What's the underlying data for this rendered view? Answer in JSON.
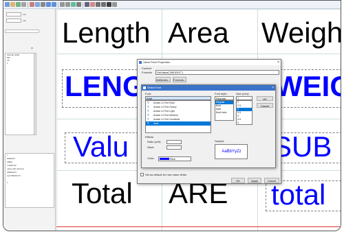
{
  "toolbar_icons": [
    "new-icon",
    "open-icon",
    "save-icon",
    "print-icon",
    "cut-icon",
    "copy-icon",
    "paste-icon",
    "undo-icon",
    "redo-icon",
    "zoom-in-icon",
    "zoom-out-icon",
    "grid-icon",
    "align-icon",
    "text-icon",
    "image-icon",
    "line-icon",
    "rect-icon",
    "barcode-icon",
    "settings-icon"
  ],
  "left_panel": {
    "field1_unit": "mm",
    "field2_unit": "mm",
    "tree_items": [
      "VALUE_SIZE",
      "MG",
      "T5",
      "1"
    ],
    "lower_items": [
      "t",
      "WEIGHT",
      "AREA",
      "\"LENGTH\"",
      "value with decimal",
      "(WEIGHT)",
      "rce(\"WEIGHT\")",
      "",
      "1"
    ]
  },
  "canvas": {
    "headers": [
      "Length",
      "Area",
      "Weigh"
    ],
    "row2": [
      "LENG",
      "WEIG"
    ],
    "row3": [
      "Valu",
      "SUB"
    ],
    "row4": [
      "Total",
      "ARE",
      "total"
    ]
  },
  "value_dialog": {
    "title": "Value Field Properties",
    "content_label": "Content",
    "formula_label": "Formula",
    "formula_value": "GetValue(\"WEIGHT\")",
    "attributes_button": "Attributes...",
    "formula_button": "Formula...",
    "checkbox_label": "Set as default for new value fields",
    "ok_button": "OK",
    "apply_button": "Apply",
    "cancel_button": "Cancel"
  },
  "font_dialog": {
    "title": "Select Font",
    "font_label": "Font:",
    "font_value": "Arial",
    "style_label": "Font style:",
    "style_value": "Regular",
    "size_label": "Size (mm):",
    "size_value": "7",
    "ok_button": "OK",
    "cancel_button": "Cancel",
    "fonts": [
      {
        "name": "Arabic UI Text Bold",
        "selected": false
      },
      {
        "name": "Arabic UI Text Heavy",
        "selected": false
      },
      {
        "name": "Arabic UI Text Light",
        "selected": false
      },
      {
        "name": "Arabic UI Text Medium",
        "selected": false
      },
      {
        "name": "Arabic UI Text Semibold",
        "selected": false
      },
      {
        "name": "Arial",
        "selected": true
      }
    ],
    "styles": [
      {
        "name": "Regular",
        "selected": true
      },
      {
        "name": "Bold",
        "selected": false
      },
      {
        "name": "Italic",
        "selected": false
      },
      {
        "name": "Bold Italic",
        "selected": false
      }
    ],
    "sizes": [
      {
        "name": "2",
        "selected": false
      },
      {
        "name": "2.5",
        "selected": false
      },
      {
        "name": "3",
        "selected": true
      },
      {
        "name": "3.5",
        "selected": false
      },
      {
        "name": "4",
        "selected": false
      },
      {
        "name": "4.5",
        "selected": false
      },
      {
        "name": "5",
        "selected": false
      }
    ],
    "effects_label": "Effects",
    "ratio_label": "Ratio (w/h):",
    "slant_label": "Slant:",
    "color_label": "Color:",
    "color_value": "Blue",
    "color_hex": "#0000ff",
    "sample_label": "Sample",
    "sample_text": "AaBbYyZz"
  }
}
